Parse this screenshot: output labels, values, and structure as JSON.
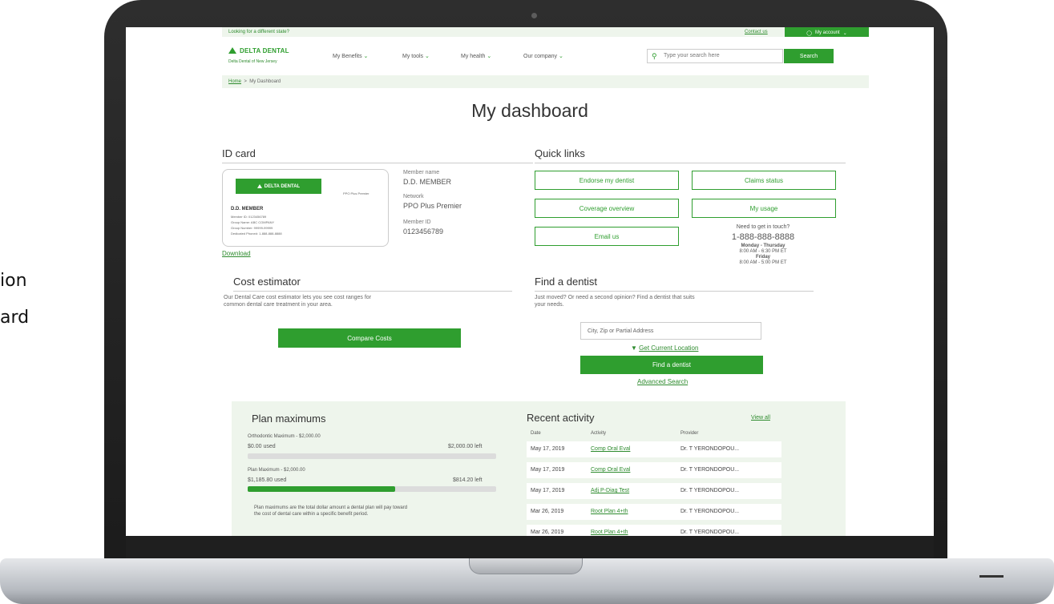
{
  "side_caption": {
    "line1": "ion",
    "line2": "ard"
  },
  "site": {
    "topbar_left": "Looking for a different state?",
    "contact": "Contact us",
    "account": "My account",
    "logo": "DELTA DENTAL",
    "logo_sub": "Delta Dental of New Jersey",
    "nav": [
      "My Benefits",
      "My tools",
      "My health",
      "Our company"
    ],
    "search_placeholder": "Type your search here",
    "search_button": "Search",
    "breadcrumb_home": "Home",
    "breadcrumb_sep": ">",
    "breadcrumb_current": "My Dashboard"
  },
  "page_title": "My dashboard",
  "id_card": {
    "heading": "ID card",
    "logo": "DELTA DENTAL",
    "network_small": "PPO Plus Premier",
    "name": "D.D. MEMBER",
    "lines": [
      "Member ID: 0123456789",
      "Group Name: ABC COMPANY",
      "Group Number: 99999-99999",
      "Dedicated Phone#: 1-888-888-8888"
    ],
    "download": "Download",
    "member_name_label": "Member name",
    "member_name": "D.D. MEMBER",
    "network_label": "Network",
    "network": "PPO Plus Premier",
    "member_id_label": "Member ID",
    "member_id": "0123456789"
  },
  "quick_links": {
    "heading": "Quick links",
    "buttons": [
      "Endorse my dentist",
      "Claims status",
      "Coverage overview",
      "My usage",
      "Email us"
    ],
    "touch_heading": "Need to get in touch?",
    "phone": "1-888-888-8888",
    "days1": "Monday - Thursday",
    "hours1": "8:00 AM - 6:30 PM ET",
    "days2": "Friday",
    "hours2": "8:00 AM - 5:00 PM ET"
  },
  "cost_estimator": {
    "heading": "Cost estimator",
    "desc1": "Our Dental Care cost estimator lets you see cost ranges for",
    "desc2": "common dental care treatment in your area.",
    "button": "Compare Costs"
  },
  "find_dentist": {
    "heading": "Find a dentist",
    "desc1": "Just moved? Or need a second opinion? Find a dentist that suits",
    "desc2": "your needs.",
    "input_placeholder": "City, Zip or Partial Address",
    "location_link": "Get Current Location",
    "button": "Find a dentist",
    "advanced": "Advanced Search"
  },
  "plan_maximums": {
    "heading": "Plan maximums",
    "items": [
      {
        "label": "Orthodontic Maximum - $2,000.00",
        "used": "$0.00 used",
        "left": "$2,000.00 left",
        "fraction_used": 0.0
      },
      {
        "label": "Plan Maximum - $2,000.00",
        "used": "$1,185.80 used",
        "left": "$814.20 left",
        "fraction_used": 0.593
      }
    ],
    "note1": "Plan maximums are the total dollar amount a dental plan will pay toward",
    "note2": "the cost of dental care within a specific benefit period."
  },
  "recent_activity": {
    "heading": "Recent activity",
    "view_all": "View all",
    "columns": [
      "Date",
      "Activity",
      "Provider"
    ],
    "rows": [
      {
        "date": "May 17, 2019",
        "activity": "Comp Oral Eval",
        "provider": "Dr. T YERONDOPOU..."
      },
      {
        "date": "May 17, 2019",
        "activity": "Comp Oral Eval",
        "provider": "Dr. T YERONDOPOU..."
      },
      {
        "date": "May 17, 2019",
        "activity": "Adj P-Diag Test",
        "provider": "Dr. T YERONDOPOU..."
      },
      {
        "date": "Mar 26, 2019",
        "activity": "Root Plan 4+th",
        "provider": "Dr. T YERONDOPOU..."
      },
      {
        "date": "Mar 26, 2019",
        "activity": "Root Plan 4+th",
        "provider": "Dr. T YERONDOPOU..."
      }
    ]
  },
  "colors": {
    "brand_green": "#2f9e2f",
    "panel_bg": "#eef5ec"
  },
  "icons": {
    "search": "search-icon",
    "account": "user-icon",
    "chevron": "chevron-down-icon",
    "location": "location-arrow-icon"
  }
}
